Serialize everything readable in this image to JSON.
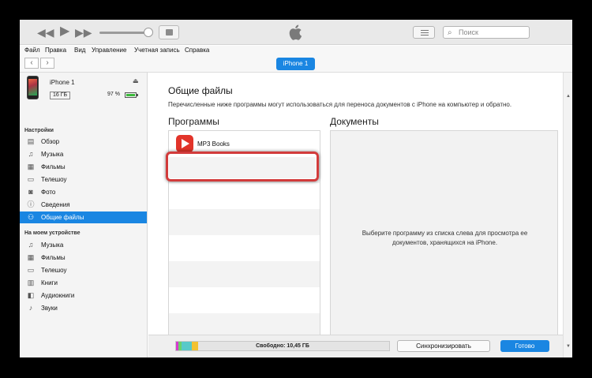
{
  "menu": [
    "Файл",
    "Правка",
    "Вид",
    "Управление",
    "Учетная запись",
    "Справка"
  ],
  "search": {
    "placeholder": "Поиск"
  },
  "nav": {
    "back": "‹",
    "forward": "›",
    "device_pill": "iPhone 1"
  },
  "device": {
    "name": "iPhone 1",
    "capacity": "16 ГБ",
    "battery_percent": "97 %",
    "battery_level": 0.97
  },
  "sidebar": {
    "settings_title": "Настройки",
    "settings": [
      {
        "label": "Обзор",
        "icon": "summary-icon"
      },
      {
        "label": "Музыка",
        "icon": "music-note-icon"
      },
      {
        "label": "Фильмы",
        "icon": "film-icon"
      },
      {
        "label": "Телешоу",
        "icon": "tv-icon"
      },
      {
        "label": "Фото",
        "icon": "camera-icon"
      },
      {
        "label": "Сведения",
        "icon": "info-icon"
      },
      {
        "label": "Общие файлы",
        "icon": "apps-share-icon",
        "active": true
      }
    ],
    "ondevice_title": "На моем устройстве",
    "ondevice": [
      {
        "label": "Музыка",
        "icon": "music-note-icon"
      },
      {
        "label": "Фильмы",
        "icon": "film-icon"
      },
      {
        "label": "Телешоу",
        "icon": "tv-icon"
      },
      {
        "label": "Книги",
        "icon": "book-icon"
      },
      {
        "label": "Аудиокниги",
        "icon": "audiobook-icon"
      },
      {
        "label": "Звуки",
        "icon": "bell-icon"
      }
    ]
  },
  "main": {
    "title": "Общие файлы",
    "description": "Перечисленные ниже программы могут использоваться для переноса документов с iPhone на компьютер и обратно.",
    "apps_header": "Программы",
    "docs_header": "Документы",
    "apps": [
      {
        "name": "MP3 Books",
        "icon": "mp3-books-app-icon"
      }
    ],
    "docs_message_line1": "Выберите программу из списка слева для просмотра ее",
    "docs_message_line2": "документов, хранящихся на iPhone."
  },
  "bottom": {
    "free_label": "Свободно: 10,45 ГБ",
    "sync_button": "Синхронизировать",
    "done_button": "Готово"
  },
  "colors": {
    "accent": "#1a86e2",
    "highlight": "#d23b3b",
    "app_icon": "#e2342a"
  }
}
